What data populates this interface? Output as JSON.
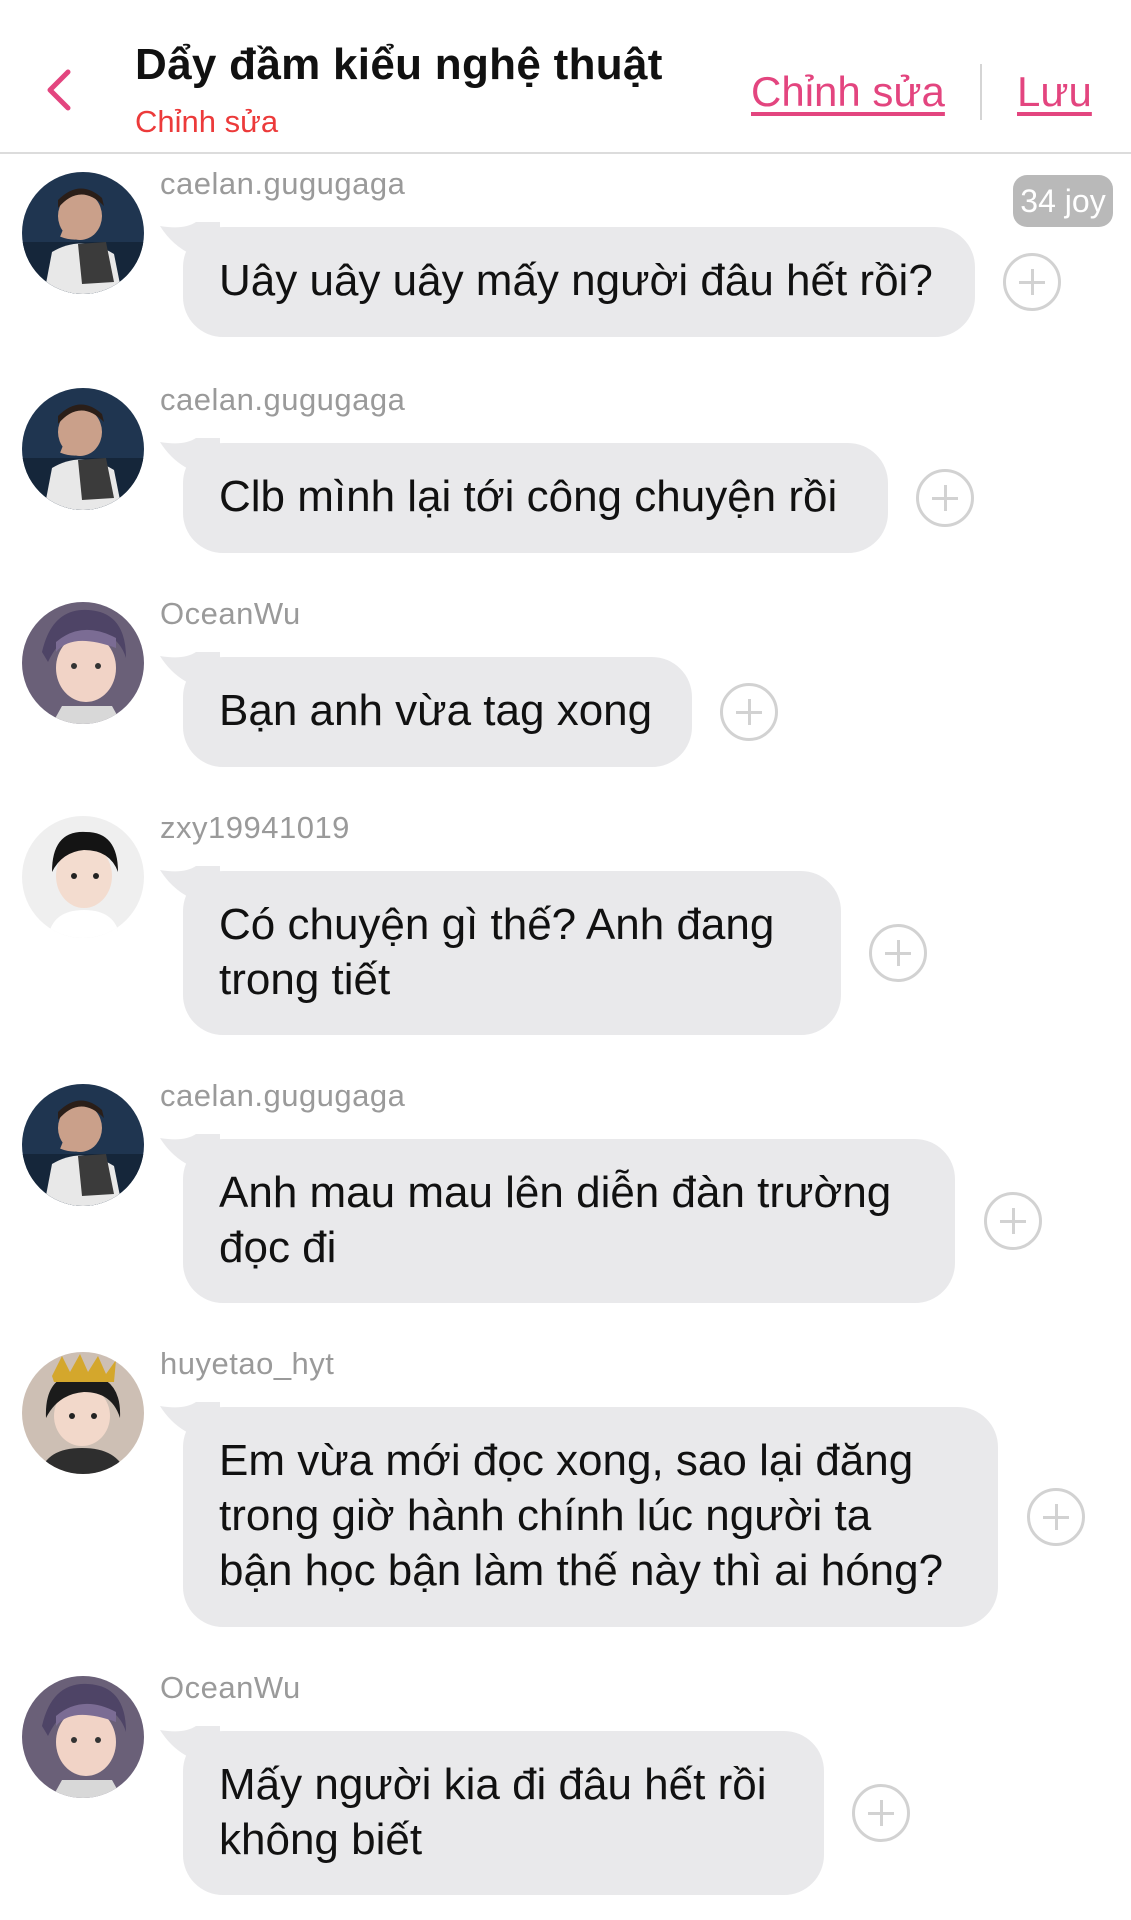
{
  "header": {
    "title": "Dẩy đầm kiểu nghệ thuật",
    "subtitle": "Chỉnh sửa",
    "edit_label": "Chỉnh sửa",
    "save_label": "Lưu",
    "back_icon": "chevron-left-icon",
    "accent_color": "#e3457f"
  },
  "badge": {
    "text": "34 joy"
  },
  "messages": [
    {
      "username": "caelan.gugugaga",
      "lines": [
        "Uây uây uây mấy người đâu hết rồi?"
      ],
      "avatar": "caelan"
    },
    {
      "username": "caelan.gugugaga",
      "lines": [
        "Clb mình lại tới công chuyện rồi"
      ],
      "avatar": "caelan"
    },
    {
      "username": "OceanWu",
      "lines": [
        "Bạn anh vừa tag xong"
      ],
      "avatar": "ocean"
    },
    {
      "username": "zxy19941019",
      "lines": [
        "Có chuyện gì thế? Anh đang",
        "trong tiết"
      ],
      "avatar": "zxy"
    },
    {
      "username": "caelan.gugugaga",
      "lines": [
        "Anh mau mau lên diễn đàn trường",
        "đọc đi"
      ],
      "avatar": "caelan"
    },
    {
      "username": "huyetao_hyt",
      "lines": [
        "Em vừa mới đọc xong, sao lại đăng",
        "trong giờ hành chính lúc người ta",
        "bận học bận làm thế này thì ai hóng?"
      ],
      "avatar": "huyetao"
    },
    {
      "username": "OceanWu",
      "lines": [
        "Mấy người kia đi đâu hết rồi",
        "không biết"
      ],
      "avatar": "ocean"
    }
  ]
}
